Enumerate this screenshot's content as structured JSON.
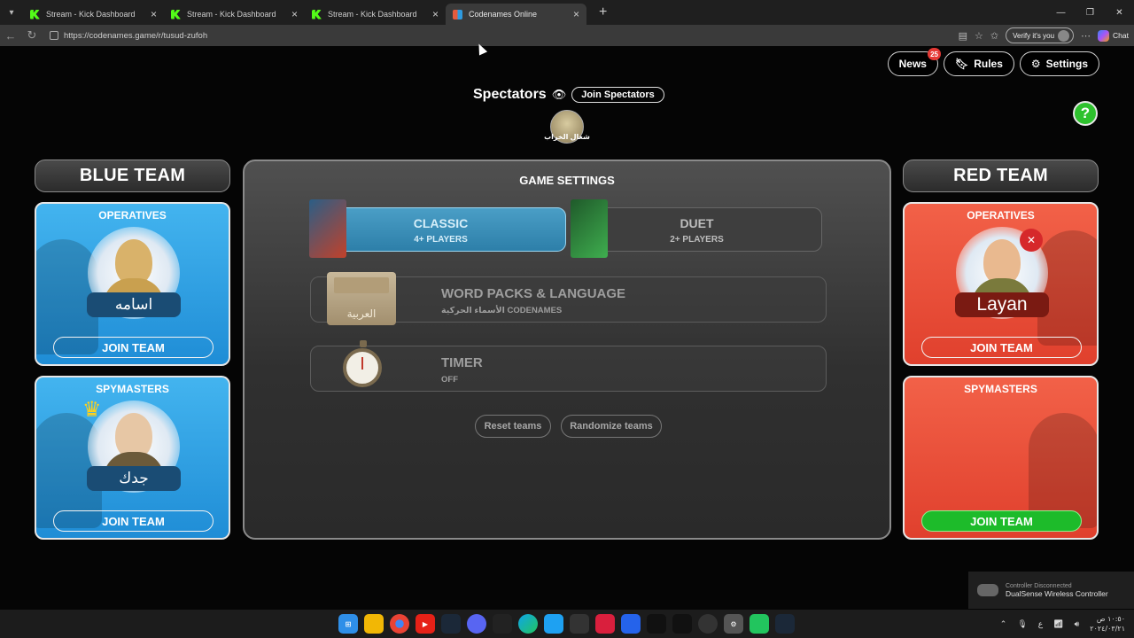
{
  "browser": {
    "tabs": [
      {
        "label": "Stream - Kick Dashboard",
        "icon": "kick-icon",
        "active": false
      },
      {
        "label": "Stream - Kick Dashboard",
        "icon": "kick-icon",
        "active": false
      },
      {
        "label": "Stream - Kick Dashboard",
        "icon": "kick-icon",
        "active": false
      },
      {
        "label": "Codenames Online",
        "icon": "codenames-icon",
        "active": true
      }
    ],
    "url": "https://codenames.game/r/tusud-zufoh",
    "verify_label": "Verify it's you",
    "chat_label": "Chat"
  },
  "header": {
    "news_label": "News",
    "news_badge": "25",
    "rules_label": "Rules",
    "settings_label": "Settings",
    "help_label": "?"
  },
  "spectators": {
    "title": "Spectators",
    "join_label": "Join Spectators",
    "member_name": "شغال الخراب"
  },
  "blue_team": {
    "title": "BLUE TEAM",
    "operatives": {
      "role": "OPERATIVES",
      "player": "اسامه",
      "join": "JOIN TEAM"
    },
    "spymasters": {
      "role": "SPYMASTERS",
      "player": "جدك",
      "join": "JOIN TEAM"
    }
  },
  "red_team": {
    "title": "RED TEAM",
    "operatives": {
      "role": "OPERATIVES",
      "player": "Layan",
      "join": "JOIN TEAM"
    },
    "spymasters": {
      "role": "SPYMASTERS",
      "join": "JOIN TEAM"
    }
  },
  "game_settings": {
    "title": "GAME SETTINGS",
    "modes": [
      {
        "name": "CLASSIC",
        "sub": "4+ PLAYERS",
        "selected": true
      },
      {
        "name": "DUET",
        "sub": "2+ PLAYERS",
        "selected": false
      }
    ],
    "word_packs": {
      "title": "WORD PACKS & LANGUAGE",
      "sub": "الأسماء الحركية CODENAMES",
      "box_label": "العربية"
    },
    "timer": {
      "title": "TIMER",
      "sub": "OFF"
    },
    "reset_label": "Reset teams",
    "randomize_label": "Randomize teams"
  },
  "toast": {
    "line1": "Controller Disconnected",
    "line2": "DualSense Wireless Controller"
  },
  "taskbar": {
    "time": "١٠:٥٠ ص",
    "date": "٢٠٢٤/٠٣/٢١",
    "lang": "ع"
  },
  "colors": {
    "blue": "#2a9fe3",
    "red": "#ec4f39",
    "green": "#1dbb2a",
    "panel": "#3a3a3a"
  }
}
